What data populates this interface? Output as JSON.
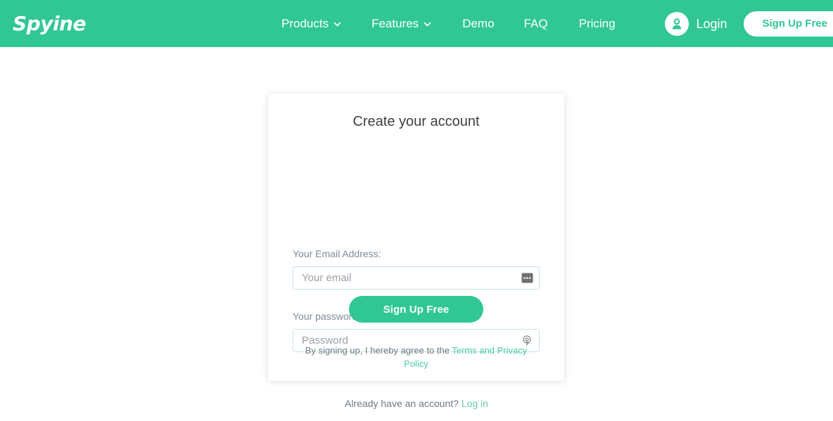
{
  "brand": {
    "logo_text": "Spyine",
    "accent_color": "#31c795",
    "link_color": "#49cda0"
  },
  "header": {
    "nav_items": [
      {
        "label": "Products",
        "has_dropdown": true,
        "icon": "chevron-down-icon"
      },
      {
        "label": "Features",
        "has_dropdown": true,
        "icon": "chevron-down-icon"
      },
      {
        "label": "Demo",
        "has_dropdown": false
      },
      {
        "label": "FAQ",
        "has_dropdown": false
      },
      {
        "label": "Pricing",
        "has_dropdown": false
      }
    ],
    "login": {
      "label": "Login",
      "icon": "user-avatar-icon"
    },
    "signup_button": {
      "label": "Sign Up Free"
    }
  },
  "card": {
    "title": "Create your account",
    "email": {
      "label": "Your Email Address:",
      "placeholder": "Your email",
      "value": "",
      "icon": "autofill-dots-icon"
    },
    "password": {
      "label": "Your password:",
      "placeholder": "Password",
      "value": "",
      "icon": "key-icon"
    },
    "submit_button": {
      "label": "Sign Up Free"
    },
    "terms": {
      "prefix": "By signing up, I hereby agree to the ",
      "link": "Terms and Privacy Policy"
    }
  },
  "footer": {
    "prompt": "Already have an account? ",
    "login_link": "Log in"
  }
}
